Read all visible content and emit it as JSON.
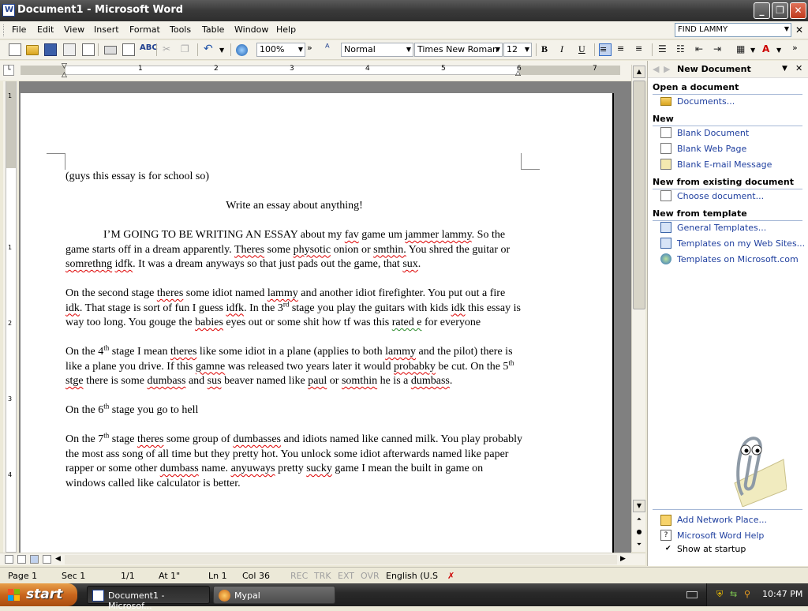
{
  "window": {
    "title": "Document1 - Microsoft Word",
    "app_icon_letter": "W",
    "minimize": "_",
    "restore": "❐",
    "close": "✕"
  },
  "menu": {
    "items": [
      "File",
      "Edit",
      "View",
      "Insert",
      "Format",
      "Tools",
      "Table",
      "Window",
      "Help"
    ],
    "ask_box_value": "FIND LAMMY",
    "doc_close": "✕"
  },
  "toolbar": {
    "zoom": "100%",
    "style": "Normal",
    "font": "Times New Roman",
    "size": "12",
    "bold": "B",
    "italic": "I",
    "underline": "U",
    "overflow": "»"
  },
  "ruler": {
    "numbers": [
      "1",
      "2",
      "3",
      "4",
      "5",
      "6",
      "7"
    ],
    "vertical_numbers": [
      "1",
      "1",
      "2",
      "3",
      "4"
    ]
  },
  "document": {
    "line1": "(guys this essay is for  school so)",
    "heading": "Write an essay about anything!",
    "p1": [
      {
        "t": "I’M GOING TO BE WRITING AN ESSAY about my "
      },
      {
        "t": "fav",
        "s": "sq"
      },
      {
        "t": " game um "
      },
      {
        "t": "jammer lammy",
        "s": "sq"
      },
      {
        "t": ". So the game starts off in a dream apparently. "
      },
      {
        "t": "Theres",
        "s": "sq"
      },
      {
        "t": " some "
      },
      {
        "t": "physotic",
        "s": "sq"
      },
      {
        "t": " onion or "
      },
      {
        "t": "smthin.",
        "s": "sq"
      },
      {
        "t": " You shred the guitar or "
      },
      {
        "t": "somrethng",
        "s": "sq"
      },
      {
        "t": " "
      },
      {
        "t": "idfk",
        "s": "sq"
      },
      {
        "t": ". It was a dream anyways so that just pads out the game, that "
      },
      {
        "t": "sux",
        "s": "sq"
      },
      {
        "t": "."
      }
    ],
    "p2": [
      {
        "t": "On the second stage "
      },
      {
        "t": "theres",
        "s": "sq"
      },
      {
        "t": " some idiot named "
      },
      {
        "t": "lammy",
        "s": "sq"
      },
      {
        "t": " and another idiot firefighter.  You put out a fire "
      },
      {
        "t": "idk",
        "s": "sq"
      },
      {
        "t": ". That stage is sort of fun I guess "
      },
      {
        "t": "idfk",
        "s": "sq"
      },
      {
        "t": ". In the 3"
      },
      {
        "t": "rd",
        "s": "sup"
      },
      {
        "t": " stage you play the guitars with kids "
      },
      {
        "t": "idk",
        "s": "sq"
      },
      {
        "t": " this essay is way too long.  You gouge the "
      },
      {
        "t": "babies",
        "s": "sq"
      },
      {
        "t": " eyes out or some shit how tf was this "
      },
      {
        "t": "rated e",
        "s": "gq"
      },
      {
        "t": " for everyone"
      }
    ],
    "p3": [
      {
        "t": "On the 4"
      },
      {
        "t": "th",
        "s": "sup"
      },
      {
        "t": " stage I mean "
      },
      {
        "t": "theres",
        "s": "sq"
      },
      {
        "t": " like some idiot in a plane (applies to both "
      },
      {
        "t": "lammy",
        "s": "sq"
      },
      {
        "t": " and the pilot) there is like a plane you drive. If this "
      },
      {
        "t": "gamne",
        "s": "sq"
      },
      {
        "t": " was released two years later it would "
      },
      {
        "t": "probabky",
        "s": "sq"
      },
      {
        "t": " be cut. On the 5"
      },
      {
        "t": "th",
        "s": "sup"
      },
      {
        "t": " "
      },
      {
        "t": "stge",
        "s": "sq"
      },
      {
        "t": " there is some "
      },
      {
        "t": "dumbass",
        "s": "sq"
      },
      {
        "t": " and "
      },
      {
        "t": "sus",
        "s": "sq"
      },
      {
        "t": " beaver named like "
      },
      {
        "t": "paul",
        "s": "sq"
      },
      {
        "t": " or "
      },
      {
        "t": "somthin",
        "s": "sq"
      },
      {
        "t": " he is a "
      },
      {
        "t": "dumbass",
        "s": "sq"
      },
      {
        "t": "."
      }
    ],
    "p4": [
      {
        "t": "On the 6"
      },
      {
        "t": "th",
        "s": "sup"
      },
      {
        "t": " stage you go to hell"
      }
    ],
    "p5": [
      {
        "t": "On the 7"
      },
      {
        "t": "th",
        "s": "sup"
      },
      {
        "t": " stage "
      },
      {
        "t": "theres",
        "s": "sq"
      },
      {
        "t": " some group of "
      },
      {
        "t": "dumbasses",
        "s": "sq"
      },
      {
        "t": " and idiots named like canned milk.  You play probably the most ass song of all time but they pretty hot. You unlock some idiot afterwards named like paper rapper or some other "
      },
      {
        "t": "dumbass",
        "s": "sq"
      },
      {
        "t": " name. "
      },
      {
        "t": "anyuways",
        "s": "sq"
      },
      {
        "t": " pretty "
      },
      {
        "t": "sucky",
        "s": "sq"
      },
      {
        "t": " game I mean the built in game on windows called like calculator is better."
      }
    ]
  },
  "status": {
    "page": "Page  1",
    "sec": "Sec  1",
    "pages": "1/1",
    "at": "At  1\"",
    "ln": "Ln  1",
    "col": "Col  36",
    "rec": "REC",
    "trk": "TRK",
    "ext": "EXT",
    "ovr": "OVR",
    "language": "English (U.S"
  },
  "taskpane": {
    "title": "New Document",
    "sections": {
      "open": "Open a document",
      "new": "New",
      "existing": "New from existing document",
      "template": "New from template"
    },
    "links": {
      "documents": "Documents...",
      "blank_document": "Blank Document",
      "blank_web": "Blank Web Page",
      "blank_email": "Blank E-mail Message",
      "choose_document": "Choose document...",
      "general_templates": "General Templates...",
      "web_templates": "Templates on my Web Sites...",
      "ms_templates": "Templates on Microsoft.com",
      "add_network": "Add Network Place...",
      "word_help": "Microsoft Word Help",
      "show_startup": "Show at startup"
    }
  },
  "taskbar": {
    "start": "start",
    "tasks": [
      "Document1 - Microsof...",
      "Mypal"
    ],
    "clock": "10:47 PM"
  },
  "colors": {
    "link": "#1f3f9f",
    "taskbar": "#2a2a2a",
    "start": "#c9661d",
    "spell_error": "#d00",
    "grammar_error": "#2a8a2a"
  }
}
